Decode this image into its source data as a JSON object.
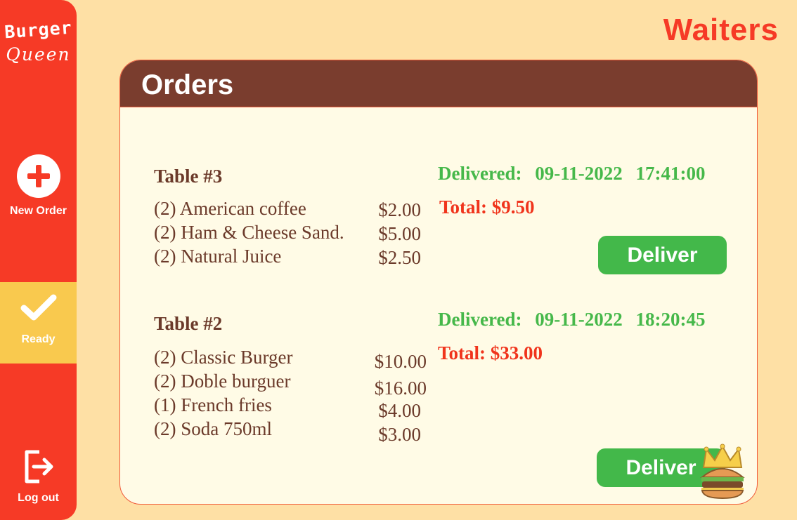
{
  "brand": {
    "line1": "Burger",
    "line2": "Queen"
  },
  "page_title": "Waiters",
  "sidebar": {
    "new_order_label": "New Order",
    "ready_label": "Ready",
    "logout_label": "Log out"
  },
  "card_title": "Orders",
  "orders": [
    {
      "table": "Table #3",
      "status_label": "Delivered:",
      "date": "09-11-2022",
      "time": "17:41:00",
      "total": "Total: $9.50",
      "deliver_label": "Deliver",
      "items": [
        {
          "name": "(2) American coffee",
          "price": "$2.00"
        },
        {
          "name": "(2) Ham & Cheese Sand.",
          "price": "$5.00"
        },
        {
          "name": "(2) Natural Juice",
          "price": "$2.50"
        }
      ]
    },
    {
      "table": "Table #2",
      "status_label": "Delivered:",
      "date": "09-11-2022",
      "time": "18:20:45",
      "total": "Total: $33.00",
      "deliver_label": "Deliver",
      "items": [
        {
          "name": "(2) Classic Burger",
          "price": "$10.00"
        },
        {
          "name": "(2) Doble burguer",
          "price": "$16.00"
        },
        {
          "name": "(1) French fries",
          "price": "$4.00"
        },
        {
          "name": "(2) Soda 750ml",
          "price": "$3.00"
        }
      ]
    }
  ],
  "colors": {
    "sidebar": "#f63a26",
    "ready_highlight": "#f9c94e",
    "card_header": "#7a3d2e",
    "delivered_green": "#46b84a",
    "total_red": "#f0341c"
  },
  "icons": [
    "plus-circle-icon",
    "checkmark-icon",
    "logout-icon",
    "crown-burger-icon"
  ]
}
